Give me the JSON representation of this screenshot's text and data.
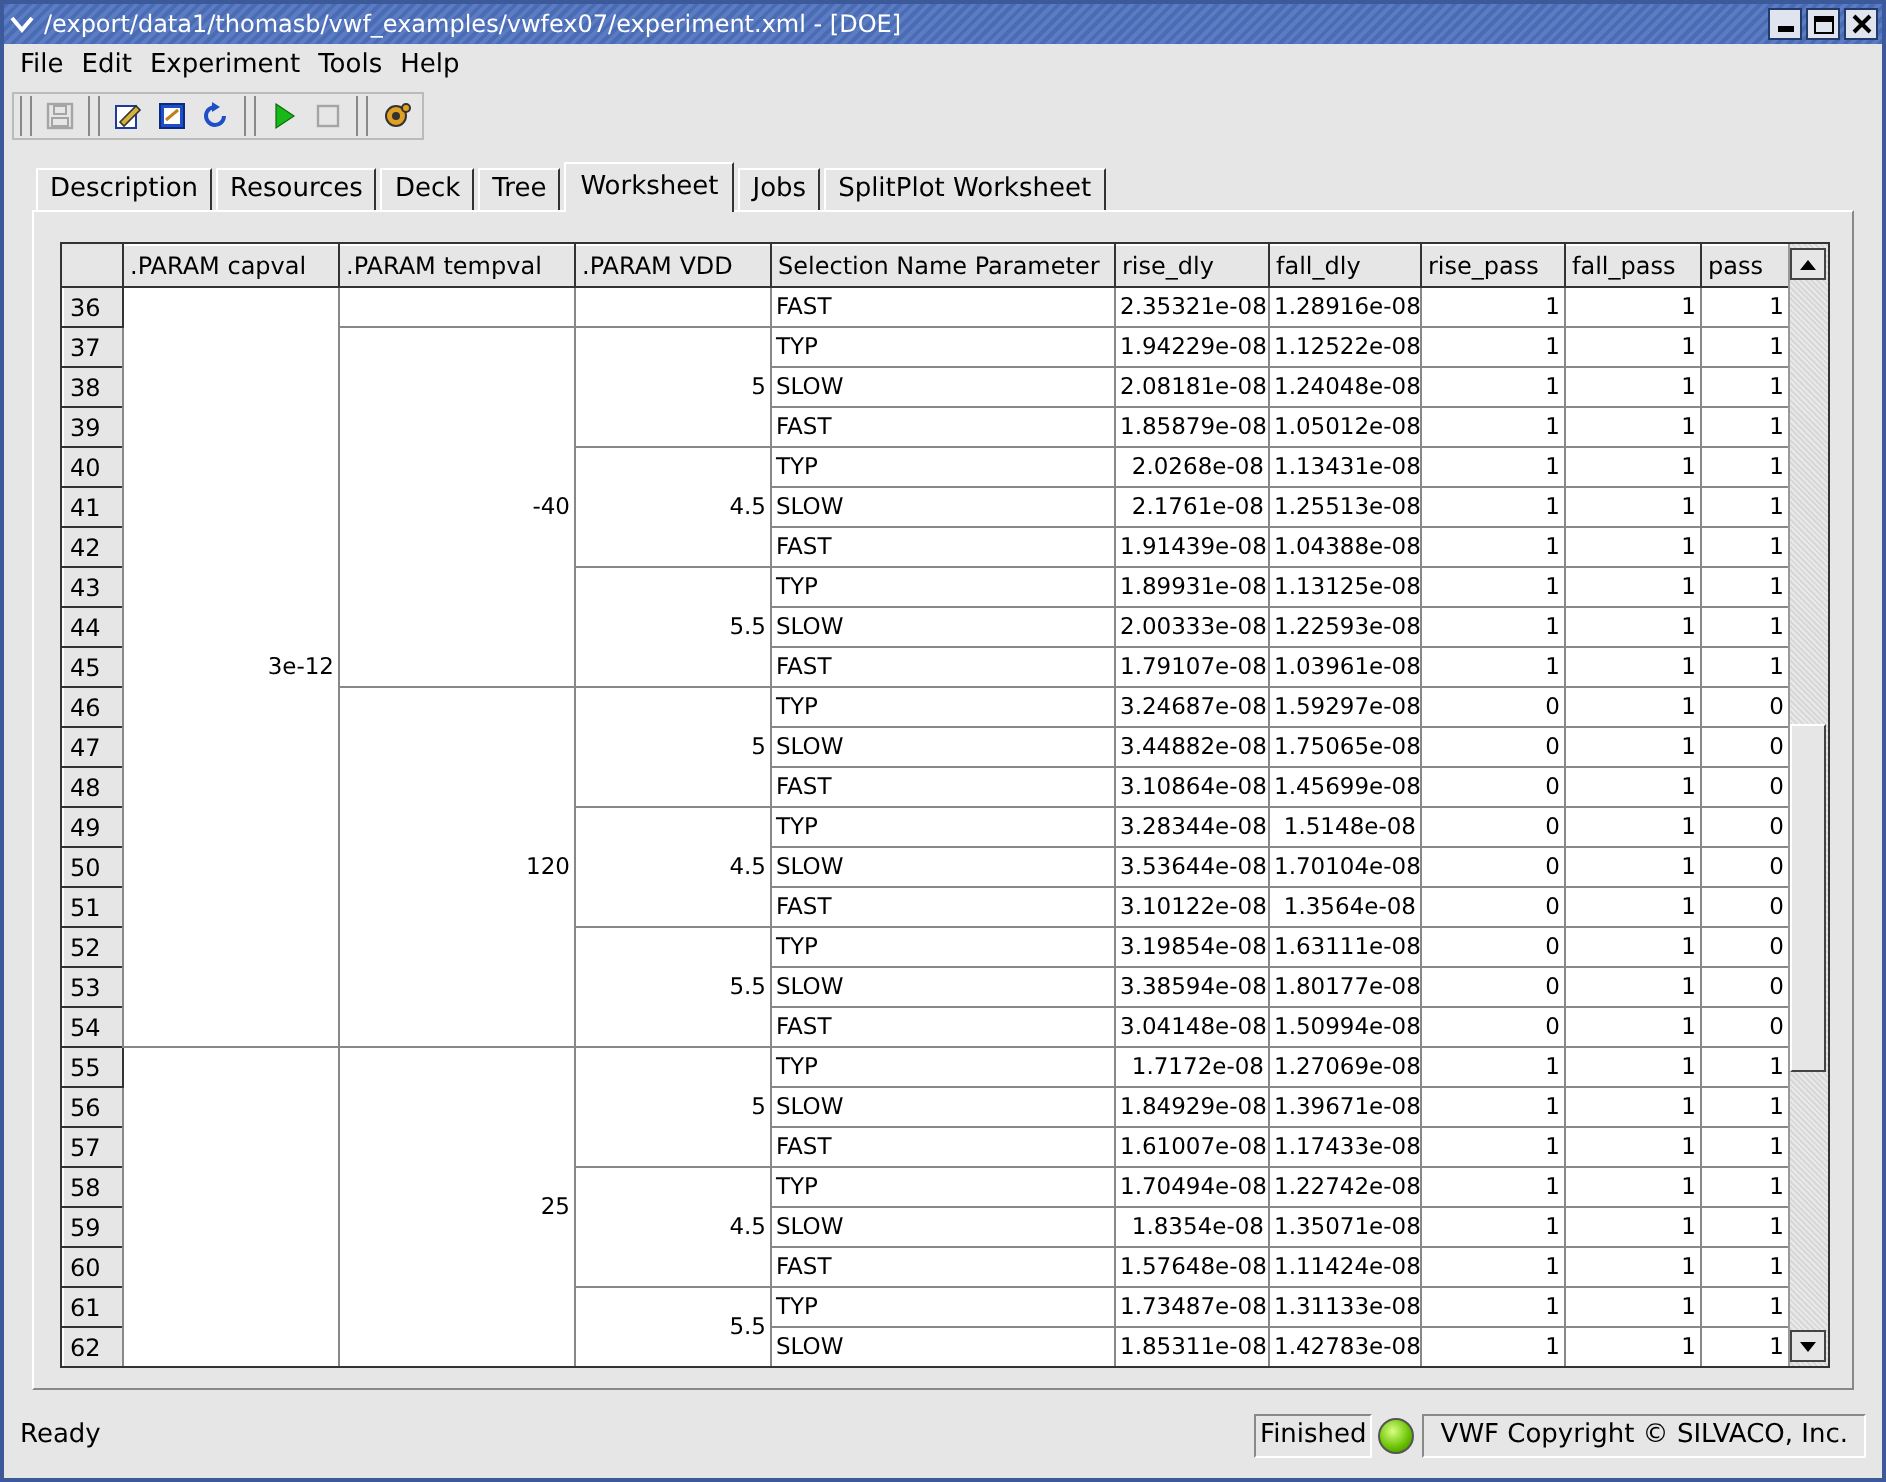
{
  "window": {
    "title": "/export/data1/thomasb/vwf_examples/vwfex07/experiment.xml - [DOE]"
  },
  "menu": [
    "File",
    "Edit",
    "Experiment",
    "Tools",
    "Help"
  ],
  "toolbar": [
    {
      "kind": "grip"
    },
    {
      "kind": "save",
      "disabled": true
    },
    {
      "kind": "grip"
    },
    {
      "kind": "edit",
      "disabled": false
    },
    {
      "kind": "edit2",
      "disabled": false
    },
    {
      "kind": "refresh",
      "disabled": false
    },
    {
      "kind": "grip"
    },
    {
      "kind": "run",
      "disabled": false
    },
    {
      "kind": "stop",
      "disabled": true
    },
    {
      "kind": "grip"
    },
    {
      "kind": "tool",
      "disabled": false
    }
  ],
  "tabs": [
    {
      "label": "Description",
      "selected": false
    },
    {
      "label": "Resources",
      "selected": false
    },
    {
      "label": "Deck",
      "selected": false
    },
    {
      "label": "Tree",
      "selected": false
    },
    {
      "label": "Worksheet",
      "selected": true
    },
    {
      "label": "Jobs",
      "selected": false
    },
    {
      "label": "SplitPlot Worksheet",
      "selected": false
    }
  ],
  "table": {
    "columns": [
      ".PARAM capval",
      ".PARAM tempval",
      ".PARAM VDD",
      "Selection Name Parameter",
      "rise_dly",
      "fall_dly",
      "rise_pass",
      "fall_pass",
      "pass"
    ],
    "groups": [
      {
        "value": "3e-12",
        "children": [
          {
            "children": [
              {
                "rows": [
                  {
                    "number": "36",
                    "cells": [
                      "FAST",
                      "2.35321e-08",
                      "1.28916e-08",
                      "1",
                      "1",
                      "1"
                    ]
                  }
                ]
              }
            ]
          },
          {
            "value": "-40",
            "children": [
              {
                "value": "5",
                "rows": [
                  {
                    "number": "37",
                    "cells": [
                      "TYP",
                      "1.94229e-08",
                      "1.12522e-08",
                      "1",
                      "1",
                      "1"
                    ]
                  },
                  {
                    "number": "38",
                    "cells": [
                      "SLOW",
                      "2.08181e-08",
                      "1.24048e-08",
                      "1",
                      "1",
                      "1"
                    ]
                  },
                  {
                    "number": "39",
                    "cells": [
                      "FAST",
                      "1.85879e-08",
                      "1.05012e-08",
                      "1",
                      "1",
                      "1"
                    ]
                  }
                ]
              },
              {
                "value": "4.5",
                "rows": [
                  {
                    "number": "40",
                    "cells": [
                      "TYP",
                      "2.0268e-08",
                      "1.13431e-08",
                      "1",
                      "1",
                      "1"
                    ]
                  },
                  {
                    "number": "41",
                    "cells": [
                      "SLOW",
                      "2.1761e-08",
                      "1.25513e-08",
                      "1",
                      "1",
                      "1"
                    ]
                  },
                  {
                    "number": "42",
                    "cells": [
                      "FAST",
                      "1.91439e-08",
                      "1.04388e-08",
                      "1",
                      "1",
                      "1"
                    ]
                  }
                ]
              },
              {
                "value": "5.5",
                "rows": [
                  {
                    "number": "43",
                    "cells": [
                      "TYP",
                      "1.89931e-08",
                      "1.13125e-08",
                      "1",
                      "1",
                      "1"
                    ]
                  },
                  {
                    "number": "44",
                    "cells": [
                      "SLOW",
                      "2.00333e-08",
                      "1.22593e-08",
                      "1",
                      "1",
                      "1"
                    ]
                  },
                  {
                    "number": "45",
                    "cells": [
                      "FAST",
                      "1.79107e-08",
                      "1.03961e-08",
                      "1",
                      "1",
                      "1"
                    ]
                  }
                ]
              }
            ]
          },
          {
            "value": "120",
            "children": [
              {
                "value": "5",
                "rows": [
                  {
                    "number": "46",
                    "cells": [
                      "TYP",
                      "3.24687e-08",
                      "1.59297e-08",
                      "0",
                      "1",
                      "0"
                    ]
                  },
                  {
                    "number": "47",
                    "cells": [
                      "SLOW",
                      "3.44882e-08",
                      "1.75065e-08",
                      "0",
                      "1",
                      "0"
                    ]
                  },
                  {
                    "number": "48",
                    "cells": [
                      "FAST",
                      "3.10864e-08",
                      "1.45699e-08",
                      "0",
                      "1",
                      "0"
                    ]
                  }
                ]
              },
              {
                "value": "4.5",
                "rows": [
                  {
                    "number": "49",
                    "cells": [
                      "TYP",
                      "3.28344e-08",
                      "1.5148e-08",
                      "0",
                      "1",
                      "0"
                    ]
                  },
                  {
                    "number": "50",
                    "cells": [
                      "SLOW",
                      "3.53644e-08",
                      "1.70104e-08",
                      "0",
                      "1",
                      "0"
                    ]
                  },
                  {
                    "number": "51",
                    "cells": [
                      "FAST",
                      "3.10122e-08",
                      "1.3564e-08",
                      "0",
                      "1",
                      "0"
                    ]
                  }
                ]
              },
              {
                "value": "5.5",
                "rows": [
                  {
                    "number": "52",
                    "cells": [
                      "TYP",
                      "3.19854e-08",
                      "1.63111e-08",
                      "0",
                      "1",
                      "0"
                    ]
                  },
                  {
                    "number": "53",
                    "cells": [
                      "SLOW",
                      "3.38594e-08",
                      "1.80177e-08",
                      "0",
                      "1",
                      "0"
                    ]
                  },
                  {
                    "number": "54",
                    "cells": [
                      "FAST",
                      "3.04148e-08",
                      "1.50994e-08",
                      "0",
                      "1",
                      "0"
                    ]
                  }
                ]
              }
            ]
          }
        ]
      },
      {
        "children": [
          {
            "value": "25",
            "children": [
              {
                "value": "5",
                "rows": [
                  {
                    "number": "55",
                    "cells": [
                      "TYP",
                      "1.7172e-08",
                      "1.27069e-08",
                      "1",
                      "1",
                      "1"
                    ]
                  },
                  {
                    "number": "56",
                    "cells": [
                      "SLOW",
                      "1.84929e-08",
                      "1.39671e-08",
                      "1",
                      "1",
                      "1"
                    ]
                  },
                  {
                    "number": "57",
                    "cells": [
                      "FAST",
                      "1.61007e-08",
                      "1.17433e-08",
                      "1",
                      "1",
                      "1"
                    ]
                  }
                ]
              },
              {
                "value": "4.5",
                "rows": [
                  {
                    "number": "58",
                    "cells": [
                      "TYP",
                      "1.70494e-08",
                      "1.22742e-08",
                      "1",
                      "1",
                      "1"
                    ]
                  },
                  {
                    "number": "59",
                    "cells": [
                      "SLOW",
                      "1.8354e-08",
                      "1.35071e-08",
                      "1",
                      "1",
                      "1"
                    ]
                  },
                  {
                    "number": "60",
                    "cells": [
                      "FAST",
                      "1.57648e-08",
                      "1.11424e-08",
                      "1",
                      "1",
                      "1"
                    ]
                  }
                ]
              },
              {
                "value": "5.5",
                "rows": [
                  {
                    "number": "61",
                    "cells": [
                      "TYP",
                      "1.73487e-08",
                      "1.31133e-08",
                      "1",
                      "1",
                      "1"
                    ]
                  },
                  {
                    "number": "62",
                    "cells": [
                      "SLOW",
                      "1.85311e-08",
                      "1.42783e-08",
                      "1",
                      "1",
                      "1"
                    ]
                  }
                ]
              }
            ]
          }
        ]
      }
    ]
  },
  "status_bar": {
    "message": "Ready",
    "job_state": "Finished",
    "copyright": "VWF Copyright ©  SILVACO, Inc."
  }
}
